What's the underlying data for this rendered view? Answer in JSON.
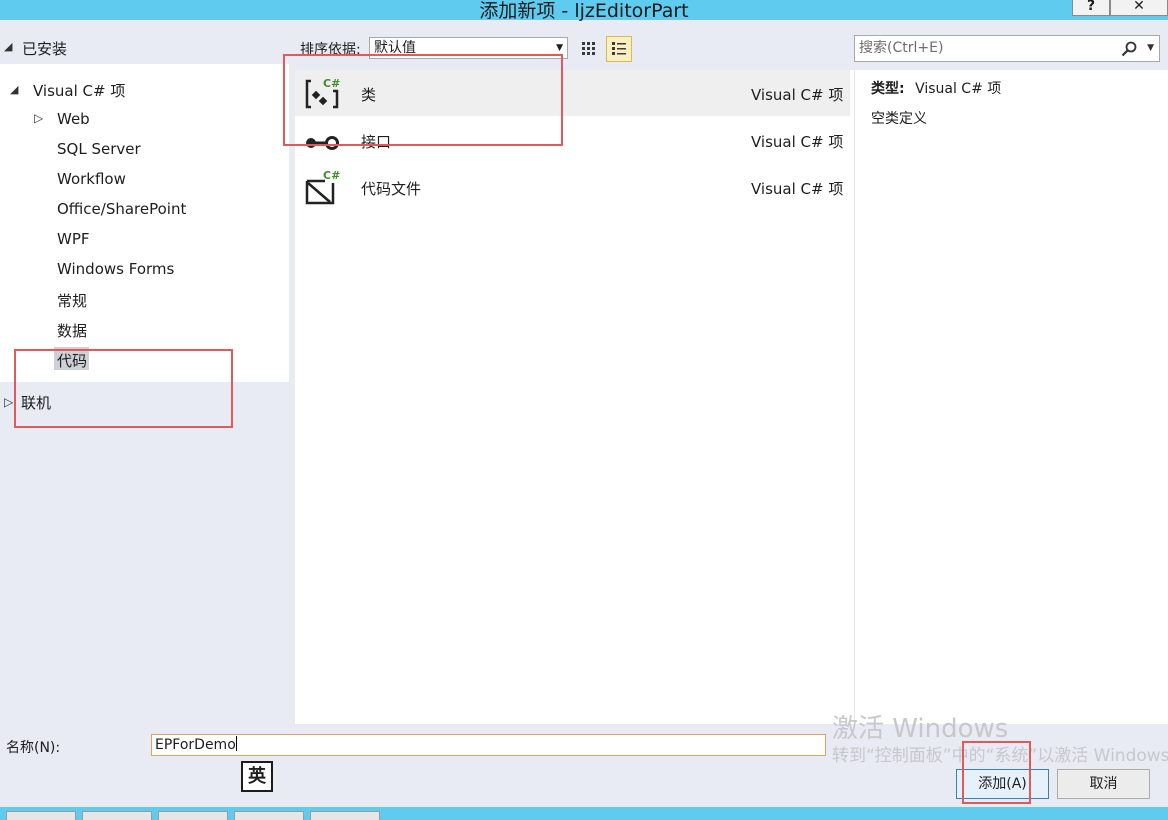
{
  "window": {
    "title": "添加新项 - ljzEditorPart",
    "help_label": "?",
    "close_label": "✕"
  },
  "left_pane": {
    "installed_label": "已安装",
    "tree": {
      "root_label": "Visual C# 项",
      "children": [
        "Web",
        "SQL Server",
        "Workflow",
        "Office/SharePoint",
        "WPF",
        "Windows Forms",
        "常规",
        "数据",
        "代码"
      ],
      "selected": "代码"
    },
    "online_label": "联机"
  },
  "toolbar": {
    "sort_label": "排序依据:",
    "sort_value": "默认值",
    "search_placeholder": "搜索(Ctrl+E)"
  },
  "items": [
    {
      "name": "类",
      "category": "Visual C# 项",
      "icon": "class-icon",
      "selected": true
    },
    {
      "name": "接口",
      "category": "Visual C# 项",
      "icon": "interface-icon",
      "selected": false
    },
    {
      "name": "代码文件",
      "category": "Visual C# 项",
      "icon": "code-file-icon",
      "selected": false
    }
  ],
  "details": {
    "type_label": "类型:",
    "type_value": "Visual C# 项",
    "description": "空类定义"
  },
  "bottom": {
    "name_label": "名称(N):",
    "name_value": "EPForDemo",
    "ime_indicator": "英",
    "add_button": "添加(A)",
    "cancel_button": "取消"
  },
  "watermark": {
    "line1": "激活 Windows",
    "line2": "转到“控制面板”中的“系统”以激活 Windows。"
  },
  "colors": {
    "title_bar": "#5ecbef",
    "pane_background": "#e8eaf4",
    "annotation_red": "#e05a59",
    "csharp_green": "#3e8e2c"
  }
}
